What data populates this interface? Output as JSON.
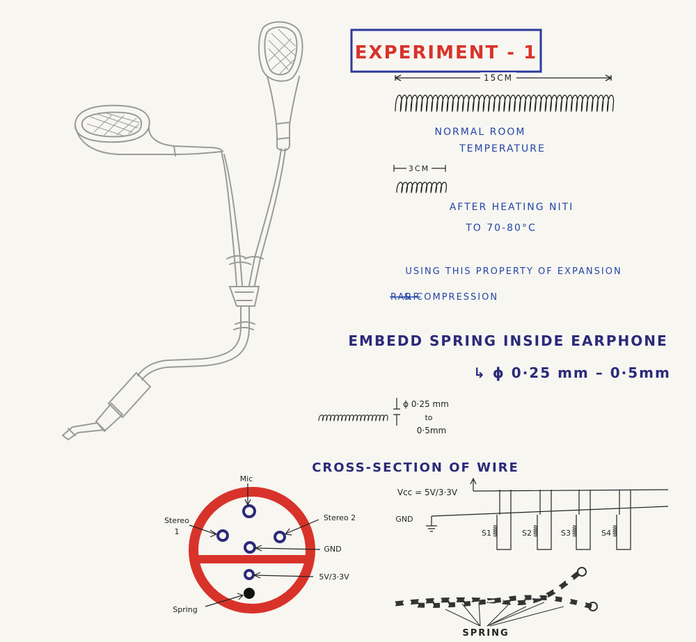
{
  "title": "Experiment - 1",
  "spring_length_label": "15cm",
  "normal_temp_line1": "Normal Room",
  "normal_temp_line2": "Temperature",
  "compressed_length_label": "3cm",
  "after_heating_line1": "After Heating NiTi",
  "after_heating_line2": "to 70-80°c",
  "property_line1": "Using this property of expansion",
  "property_line2_strike": "rarf",
  "property_line2": "& compression",
  "embed_heading": "Embedd spring inside earphone",
  "embed_diameter": "↳ ϕ 0·25 mm – 0·5mm",
  "diameter_note_line1": "ϕ 0·25 mm",
  "diameter_note_line2": "to",
  "diameter_note_line3": "0·5mm",
  "cross_section_heading": "Cross-section of wire",
  "cross_section_labels": {
    "mic": "Mic",
    "stereo1_line1": "Stereo",
    "stereo1_line2": "1",
    "stereo2": "Stereo 2",
    "gnd": "GND",
    "power": "5V/3·3V",
    "spring": "Spring"
  },
  "circuit_labels": {
    "vcc": "Vcc = 5V/3·3V",
    "gnd": "GND",
    "switches": [
      "S1",
      "S2",
      "S3",
      "S4"
    ]
  },
  "bottom_label": "Spring",
  "colors": {
    "title_red": "#d8332a",
    "title_border": "#2b3a9c",
    "ink_blue": "#2446a6",
    "ink_navy": "#2b2a7a",
    "cross_section_red": "#d8332a",
    "pencil": "#9a9a9a"
  }
}
